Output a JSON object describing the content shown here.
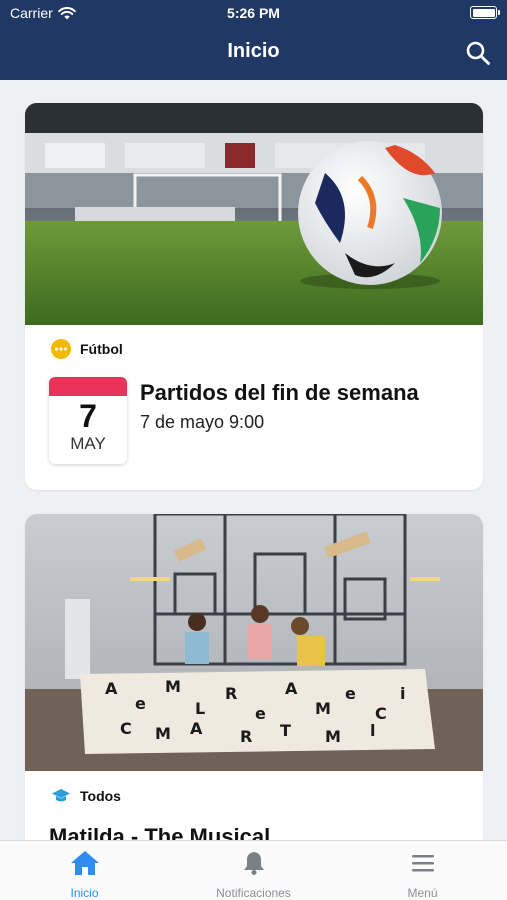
{
  "status_bar": {
    "carrier": "Carrier",
    "time": "5:26 PM"
  },
  "header": {
    "title": "Inicio",
    "search_icon": "search-icon"
  },
  "cards": [
    {
      "image": "soccer-ball-on-stadium-grass",
      "category": "Fútbol",
      "category_icon": "ellipsis-circle-icon",
      "category_color": "#f5b800",
      "calendar": {
        "day": "7",
        "month": "MAY"
      },
      "title": "Partidos del fin de semana",
      "date": "7 de mayo 9:00"
    },
    {
      "image": "theatre-rehearsal-stage",
      "category": "Todos",
      "category_icon": "graduation-cap-icon",
      "category_color": "#2d9cdb",
      "title": "Matilda - The Musical"
    }
  ],
  "tabs": [
    {
      "label": "Inicio",
      "icon": "home-icon",
      "active": true
    },
    {
      "label": "Notificaciones",
      "icon": "bell-icon",
      "active": false
    },
    {
      "label": "Menú",
      "icon": "menu-icon",
      "active": false
    }
  ],
  "colors": {
    "header_bg": "#1f3864",
    "accent": "#2f8cf0",
    "calendar_red": "#e8345a"
  }
}
